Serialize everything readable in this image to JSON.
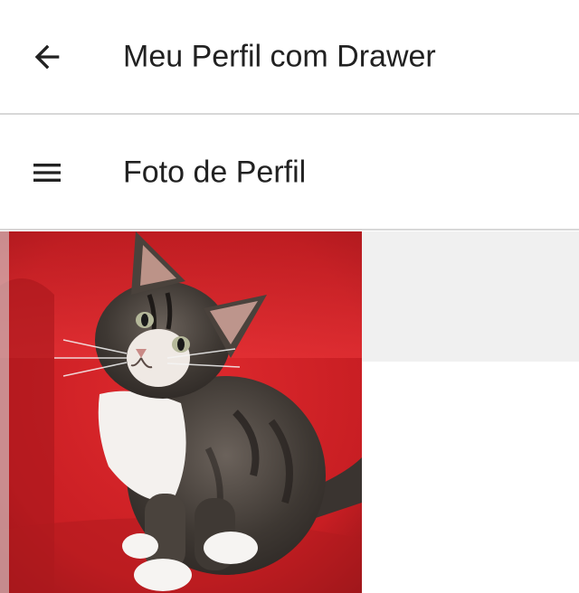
{
  "toolbar": {
    "title": "Meu Perfil com Drawer",
    "back_icon": "arrow-back-icon"
  },
  "section_bar": {
    "title": "Foto de Perfil",
    "menu_icon": "hamburger-menu-icon"
  },
  "colors": {
    "title_text": "#212121",
    "divider": "#d8d8d8",
    "side_panel": "#f0f0f0",
    "chair_red": "#d8262a"
  }
}
